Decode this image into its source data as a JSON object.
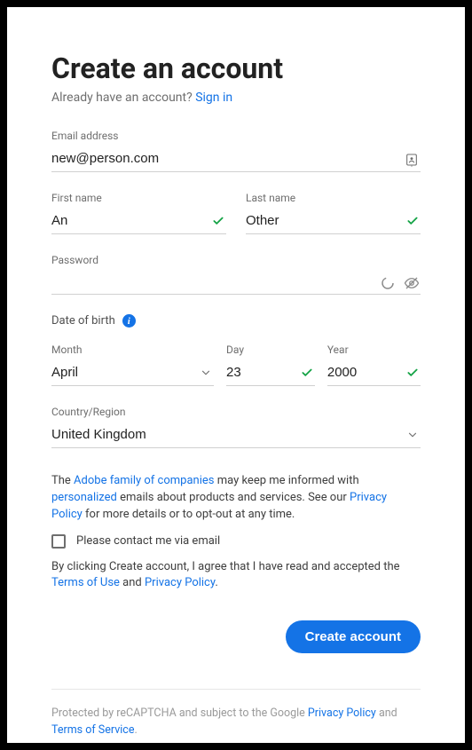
{
  "header": {
    "title": "Create an account",
    "already": "Already have an account?",
    "signin": "Sign in"
  },
  "email": {
    "label": "Email address",
    "value": "new@person.com"
  },
  "firstname": {
    "label": "First name",
    "value": "An"
  },
  "lastname": {
    "label": "Last name",
    "value": "Other"
  },
  "password": {
    "label": "Password"
  },
  "dob": {
    "heading": "Date of birth",
    "month": {
      "label": "Month",
      "value": "April"
    },
    "day": {
      "label": "Day",
      "value": "23"
    },
    "year": {
      "label": "Year",
      "value": "2000"
    }
  },
  "country": {
    "label": "Country/Region",
    "value": "United Kingdom"
  },
  "legal1": {
    "pre": "The ",
    "adobe": "Adobe family of companies",
    "mid1": " may keep me informed with ",
    "personalized": "personalized",
    "mid2": " emails about products and services. See our ",
    "privacy": "Privacy Policy",
    "post": " for more details or to opt-out at any time."
  },
  "contact": {
    "label": "Please contact me via email",
    "checked": false
  },
  "legal2": {
    "pre": "By clicking Create account, I agree that I have read and accepted the ",
    "tou": "Terms of Use",
    "mid": " and ",
    "privacy": "Privacy Policy",
    "post": "."
  },
  "cta": "Create account",
  "footer": {
    "pre": "Protected by reCAPTCHA and subject to the Google ",
    "privacy": "Privacy Policy",
    "mid": " and ",
    "tos": "Terms of Service",
    "post": "."
  }
}
